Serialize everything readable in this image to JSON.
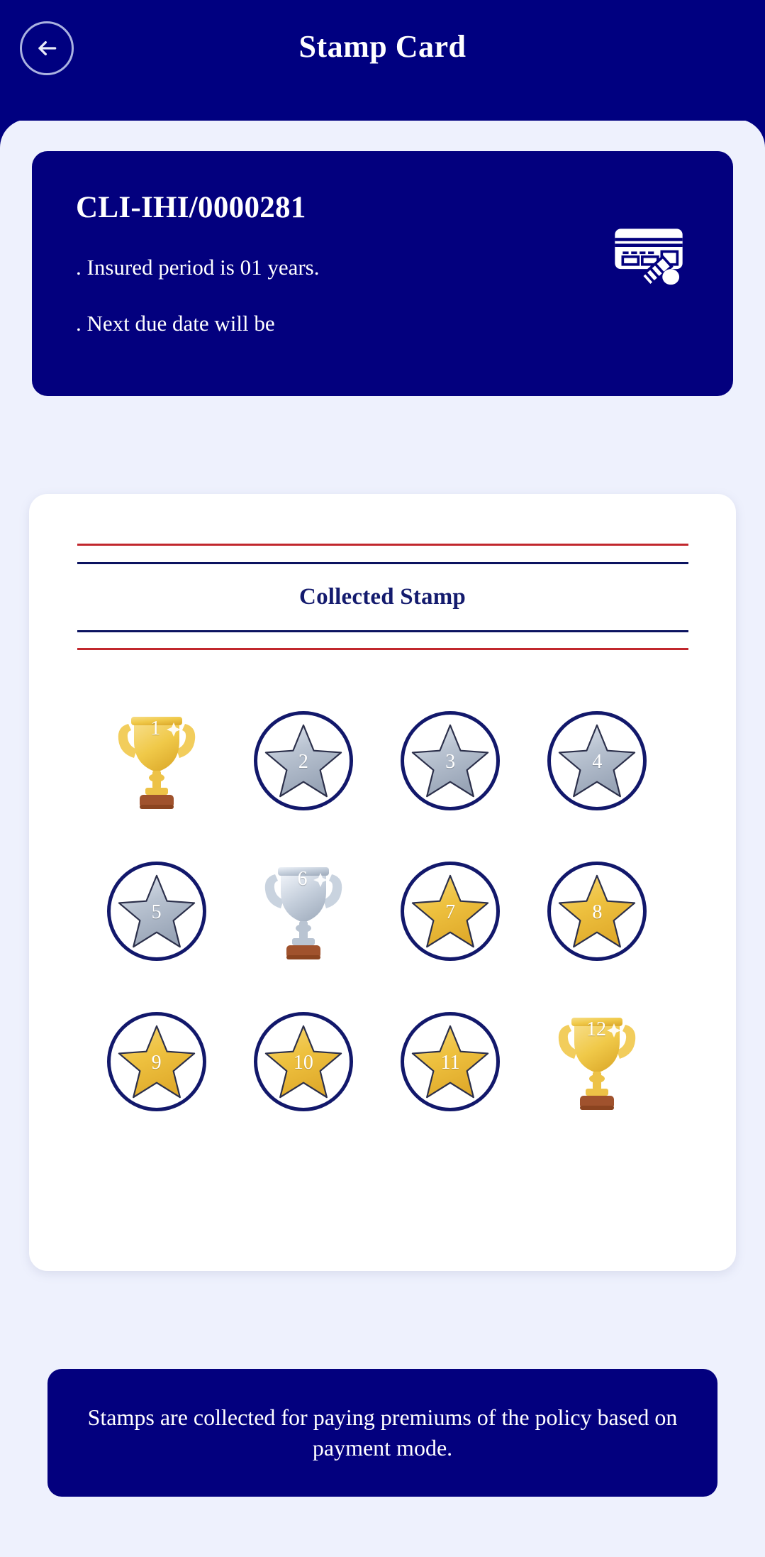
{
  "header": {
    "title": "Stamp Card",
    "back_icon": "arrow-left-icon"
  },
  "policy_card": {
    "policy_number": "CLI-IHI/0000281",
    "line_1": ". Insured period is 01 years.",
    "line_2": ". Next due date will be",
    "icon": "credit-card-payment-icon",
    "background_color": "#03007e"
  },
  "stamp_panel": {
    "title": "Collected Stamp",
    "rule_red_color": "#c1272d",
    "rule_navy_color": "#0b1360",
    "stamps": [
      {
        "number": "1",
        "type": "trophy",
        "tier": "gold",
        "circled": false
      },
      {
        "number": "2",
        "type": "star",
        "tier": "silver",
        "circled": true
      },
      {
        "number": "3",
        "type": "star",
        "tier": "silver",
        "circled": true
      },
      {
        "number": "4",
        "type": "star",
        "tier": "silver",
        "circled": true
      },
      {
        "number": "5",
        "type": "star",
        "tier": "silver",
        "circled": true
      },
      {
        "number": "6",
        "type": "trophy",
        "tier": "silver",
        "circled": false
      },
      {
        "number": "7",
        "type": "star",
        "tier": "gold",
        "circled": true
      },
      {
        "number": "8",
        "type": "star",
        "tier": "gold",
        "circled": true
      },
      {
        "number": "9",
        "type": "star",
        "tier": "gold",
        "circled": true
      },
      {
        "number": "10",
        "type": "star",
        "tier": "gold",
        "circled": true
      },
      {
        "number": "11",
        "type": "star",
        "tier": "gold",
        "circled": true
      },
      {
        "number": "12",
        "type": "trophy",
        "tier": "gold",
        "circled": false
      }
    ]
  },
  "note": {
    "text": "Stamps are collected for paying premiums of the policy based on payment mode."
  },
  "colors": {
    "header_navy": "#000080",
    "card_navy": "#03007e",
    "sheet_bg": "#eef1fd",
    "panel_white": "#ffffff",
    "circle_outline": "#12186b",
    "gold": "#efc242",
    "silver": "#b6bfcd"
  }
}
